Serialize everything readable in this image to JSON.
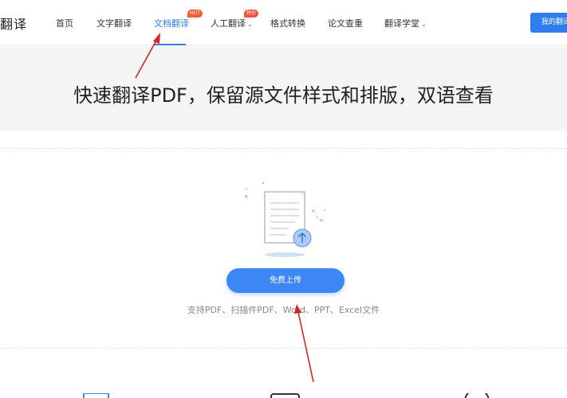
{
  "header": {
    "logo_text": "翻译",
    "nav": [
      {
        "label": "首页"
      },
      {
        "label": "文字翻译"
      },
      {
        "label": "文档翻译",
        "badge": "HOT",
        "active": true
      },
      {
        "label": "人工翻译",
        "badge": "特价",
        "caret": "⌄"
      },
      {
        "label": "格式转换"
      },
      {
        "label": "论文查重"
      },
      {
        "label": "翻译学堂",
        "caret": "⌄"
      }
    ],
    "user_button": "我的翻译"
  },
  "hero": {
    "title": "快速翻译PDF，保留源文件样式和排版，双语查看"
  },
  "upload": {
    "button_label": "免费上传",
    "formats_text": "支持PDF、扫描件PDF、Word、PPT、Excel文件"
  },
  "colors": {
    "accent": "#2f7ef0",
    "hot_badge": "#f45a36",
    "annotation_arrow": "#d9232b",
    "hero_bg": "#f4f4f5"
  },
  "icons": [
    "document-upload-icon",
    "upload-arrow-icon",
    "chevron-down-icon",
    "red-annotation-arrow"
  ]
}
